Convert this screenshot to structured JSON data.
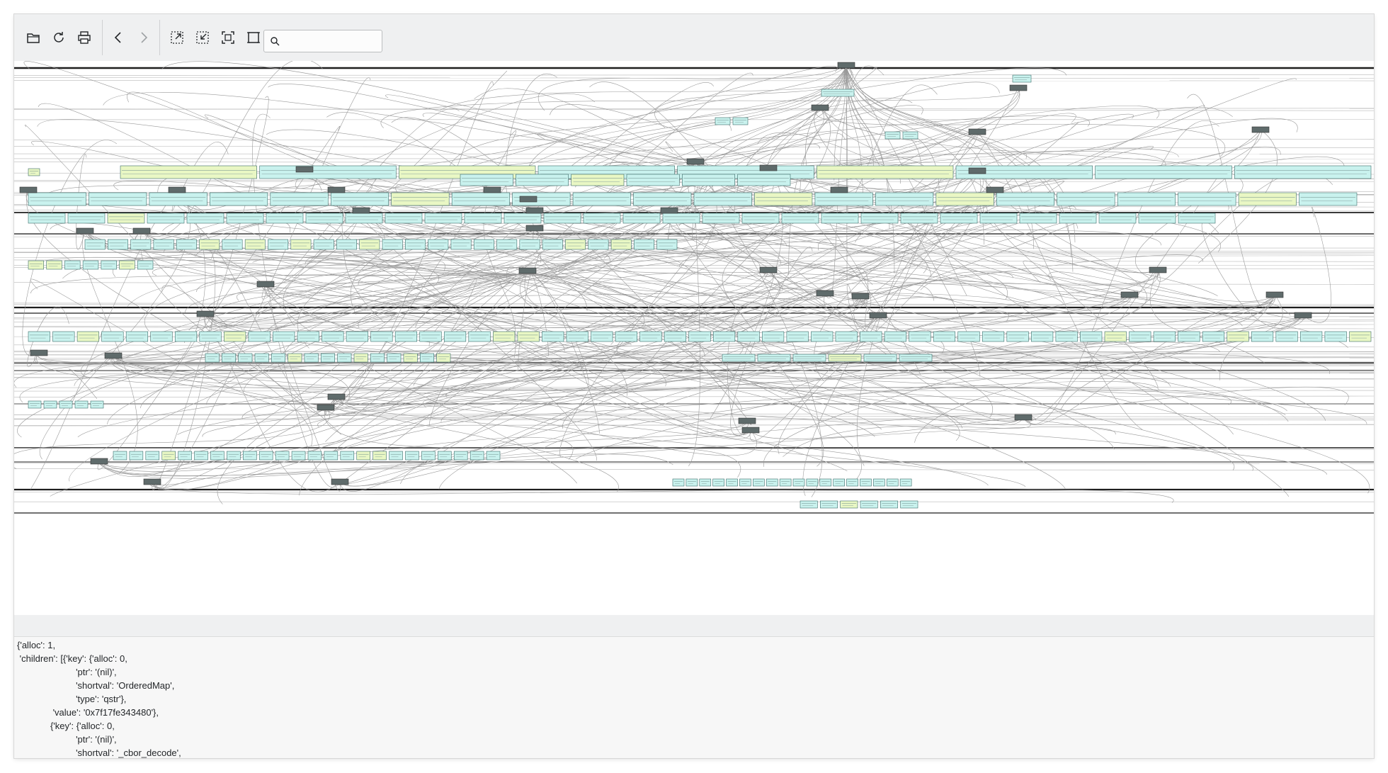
{
  "toolbar": {
    "buttons": [
      {
        "name": "open-file-button",
        "icon": "folder-open-icon"
      },
      {
        "name": "reload-button",
        "icon": "refresh-icon"
      },
      {
        "name": "print-button",
        "icon": "printer-icon"
      },
      {
        "name": "back-button",
        "icon": "chevron-left-icon"
      },
      {
        "name": "forward-button",
        "icon": "chevron-right-icon"
      },
      {
        "name": "zoom-in-button",
        "icon": "zoom-in-icon"
      },
      {
        "name": "zoom-out-button",
        "icon": "zoom-out-icon"
      },
      {
        "name": "zoom-fit-button",
        "icon": "zoom-fit-icon"
      },
      {
        "name": "zoom-original-button",
        "icon": "zoom-original-icon"
      }
    ],
    "search": {
      "placeholder": "",
      "value": "",
      "icon": "search-icon"
    }
  },
  "graph": {
    "header_node_color": "#5f6b6b",
    "value_node_color": "#c9f2ee",
    "highlight_node_color": "#e9f7c4",
    "edge_color": "#9a9a9a",
    "bus_color": "#1e1e1e"
  },
  "details": {
    "lines": [
      "{'alloc': 1,",
      " 'children': [{'key': {'alloc': 0,",
      "                       'ptr': '(nil)',",
      "                       'shortval': 'OrderedMap',",
      "                       'type': 'qstr'},",
      "              'value': '0x7f17fe343480'},",
      "             {'key': {'alloc': 0,",
      "                       'ptr': '(nil)',",
      "                       'shortval': '_cbor_decode',"
    ]
  }
}
